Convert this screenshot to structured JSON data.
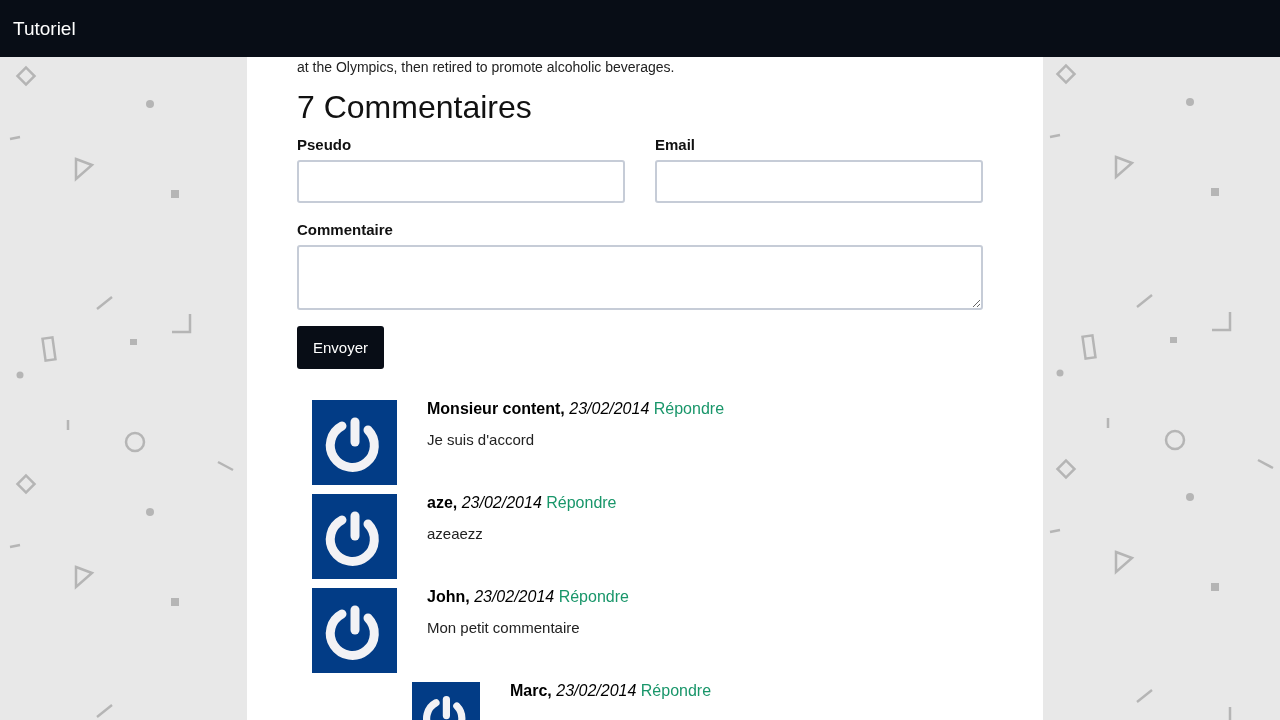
{
  "header": {
    "title": "Tutoriel"
  },
  "article": {
    "last_line": "at the Olympics, then retired to promote alcoholic beverages."
  },
  "comments_section": {
    "heading": "7 Commentaires",
    "form": {
      "fields": [
        {
          "kind": "input",
          "label": "Pseudo"
        },
        {
          "kind": "input",
          "label": "Email"
        },
        {
          "kind": "textarea",
          "label": "Commentaire"
        }
      ],
      "submit": "Envoyer"
    },
    "comments": [
      {
        "author": "Monsieur content,",
        "date": "23/02/2014",
        "reply": "Répondre",
        "text": "Je suis d'accord"
      },
      {
        "author": "aze,",
        "date": "23/02/2014",
        "reply": "Répondre",
        "text": "azeaezz"
      },
      {
        "author": "John,",
        "date": "23/02/2014",
        "reply": "Répondre",
        "text": "Mon petit commentaire",
        "children": [
          {
            "author": "Marc,",
            "date": "23/02/2014",
            "reply": "Répondre"
          }
        ]
      }
    ]
  }
}
